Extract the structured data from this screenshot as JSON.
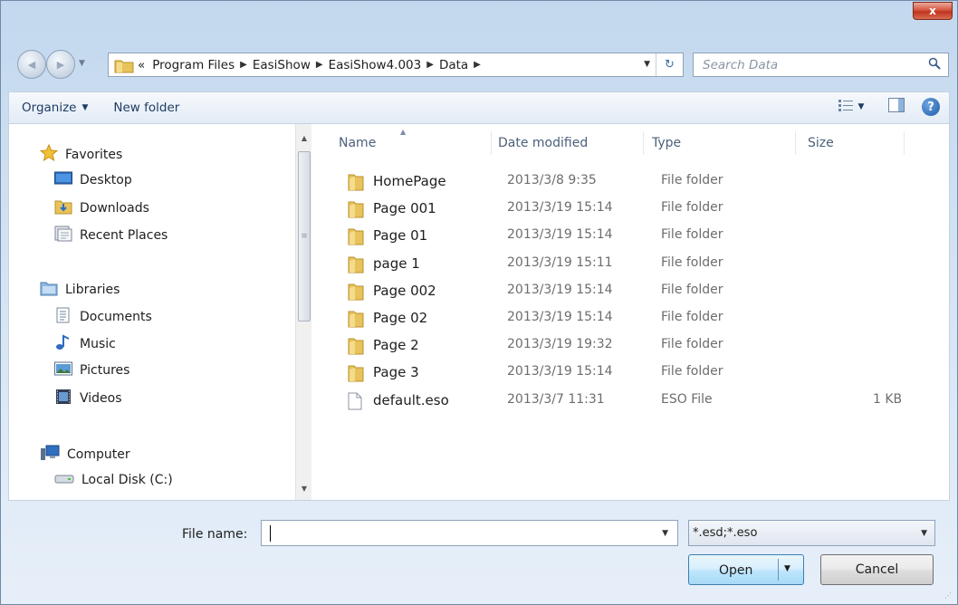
{
  "window": {
    "close_glyph": "x"
  },
  "nav": {
    "back_glyph": "◀",
    "forward_glyph": "▶",
    "recent_glyph": "▼",
    "breadcrumb_prefix": "«",
    "crumbs": [
      "Program Files",
      "EasiShow",
      "EasiShow4.003",
      "Data"
    ],
    "crumb_separator": "▶",
    "address_dropdown": "▼",
    "refresh_glyph": "↻",
    "search_placeholder": "Search Data",
    "search_icon": "search-icon"
  },
  "toolbar": {
    "organize_label": "Organize",
    "organize_arrow": "▼",
    "new_folder_label": "New folder",
    "views_arrow": "▼",
    "help_glyph": "?"
  },
  "navtree": {
    "favorites": "Favorites",
    "desktop": "Desktop",
    "downloads": "Downloads",
    "recent_places": "Recent Places",
    "libraries": "Libraries",
    "documents": "Documents",
    "music": "Music",
    "pictures": "Pictures",
    "videos": "Videos",
    "computer": "Computer",
    "local_disk": "Local Disk (C:)",
    "scroll_up": "▲",
    "scroll_down": "▼",
    "scroll_grip": "≡"
  },
  "columns": {
    "name": "Name",
    "date": "Date modified",
    "type": "Type",
    "size": "Size",
    "sort_glyph": "▲"
  },
  "files": [
    {
      "name": "HomePage",
      "date": "2013/3/8 9:35",
      "type": "File folder",
      "size": "",
      "kind": "folder"
    },
    {
      "name": "Page 001",
      "date": "2013/3/19 15:14",
      "type": "File folder",
      "size": "",
      "kind": "folder"
    },
    {
      "name": "Page 01",
      "date": "2013/3/19 15:14",
      "type": "File folder",
      "size": "",
      "kind": "folder"
    },
    {
      "name": "page 1",
      "date": "2013/3/19 15:11",
      "type": "File folder",
      "size": "",
      "kind": "folder"
    },
    {
      "name": "Page 002",
      "date": "2013/3/19 15:14",
      "type": "File folder",
      "size": "",
      "kind": "folder"
    },
    {
      "name": "Page 02",
      "date": "2013/3/19 15:14",
      "type": "File folder",
      "size": "",
      "kind": "folder"
    },
    {
      "name": "Page 2",
      "date": "2013/3/19 19:32",
      "type": "File folder",
      "size": "",
      "kind": "folder"
    },
    {
      "name": "Page 3",
      "date": "2013/3/19 15:14",
      "type": "File folder",
      "size": "",
      "kind": "folder"
    },
    {
      "name": "default.eso",
      "date": "2013/3/7 11:31",
      "type": "ESO File",
      "size": "1 KB",
      "kind": "file"
    }
  ],
  "bottom": {
    "filename_label": "File name:",
    "filename_value": "",
    "filename_drop": "▼",
    "filter_value": "*.esd;*.eso",
    "filter_drop": "▼",
    "open_label": "Open",
    "open_arrow": "▼",
    "cancel_label": "Cancel",
    "grip": "⋰"
  },
  "colors": {
    "folder": "#e8c25a",
    "accent": "#3c7fb1",
    "close": "#c0351d"
  }
}
